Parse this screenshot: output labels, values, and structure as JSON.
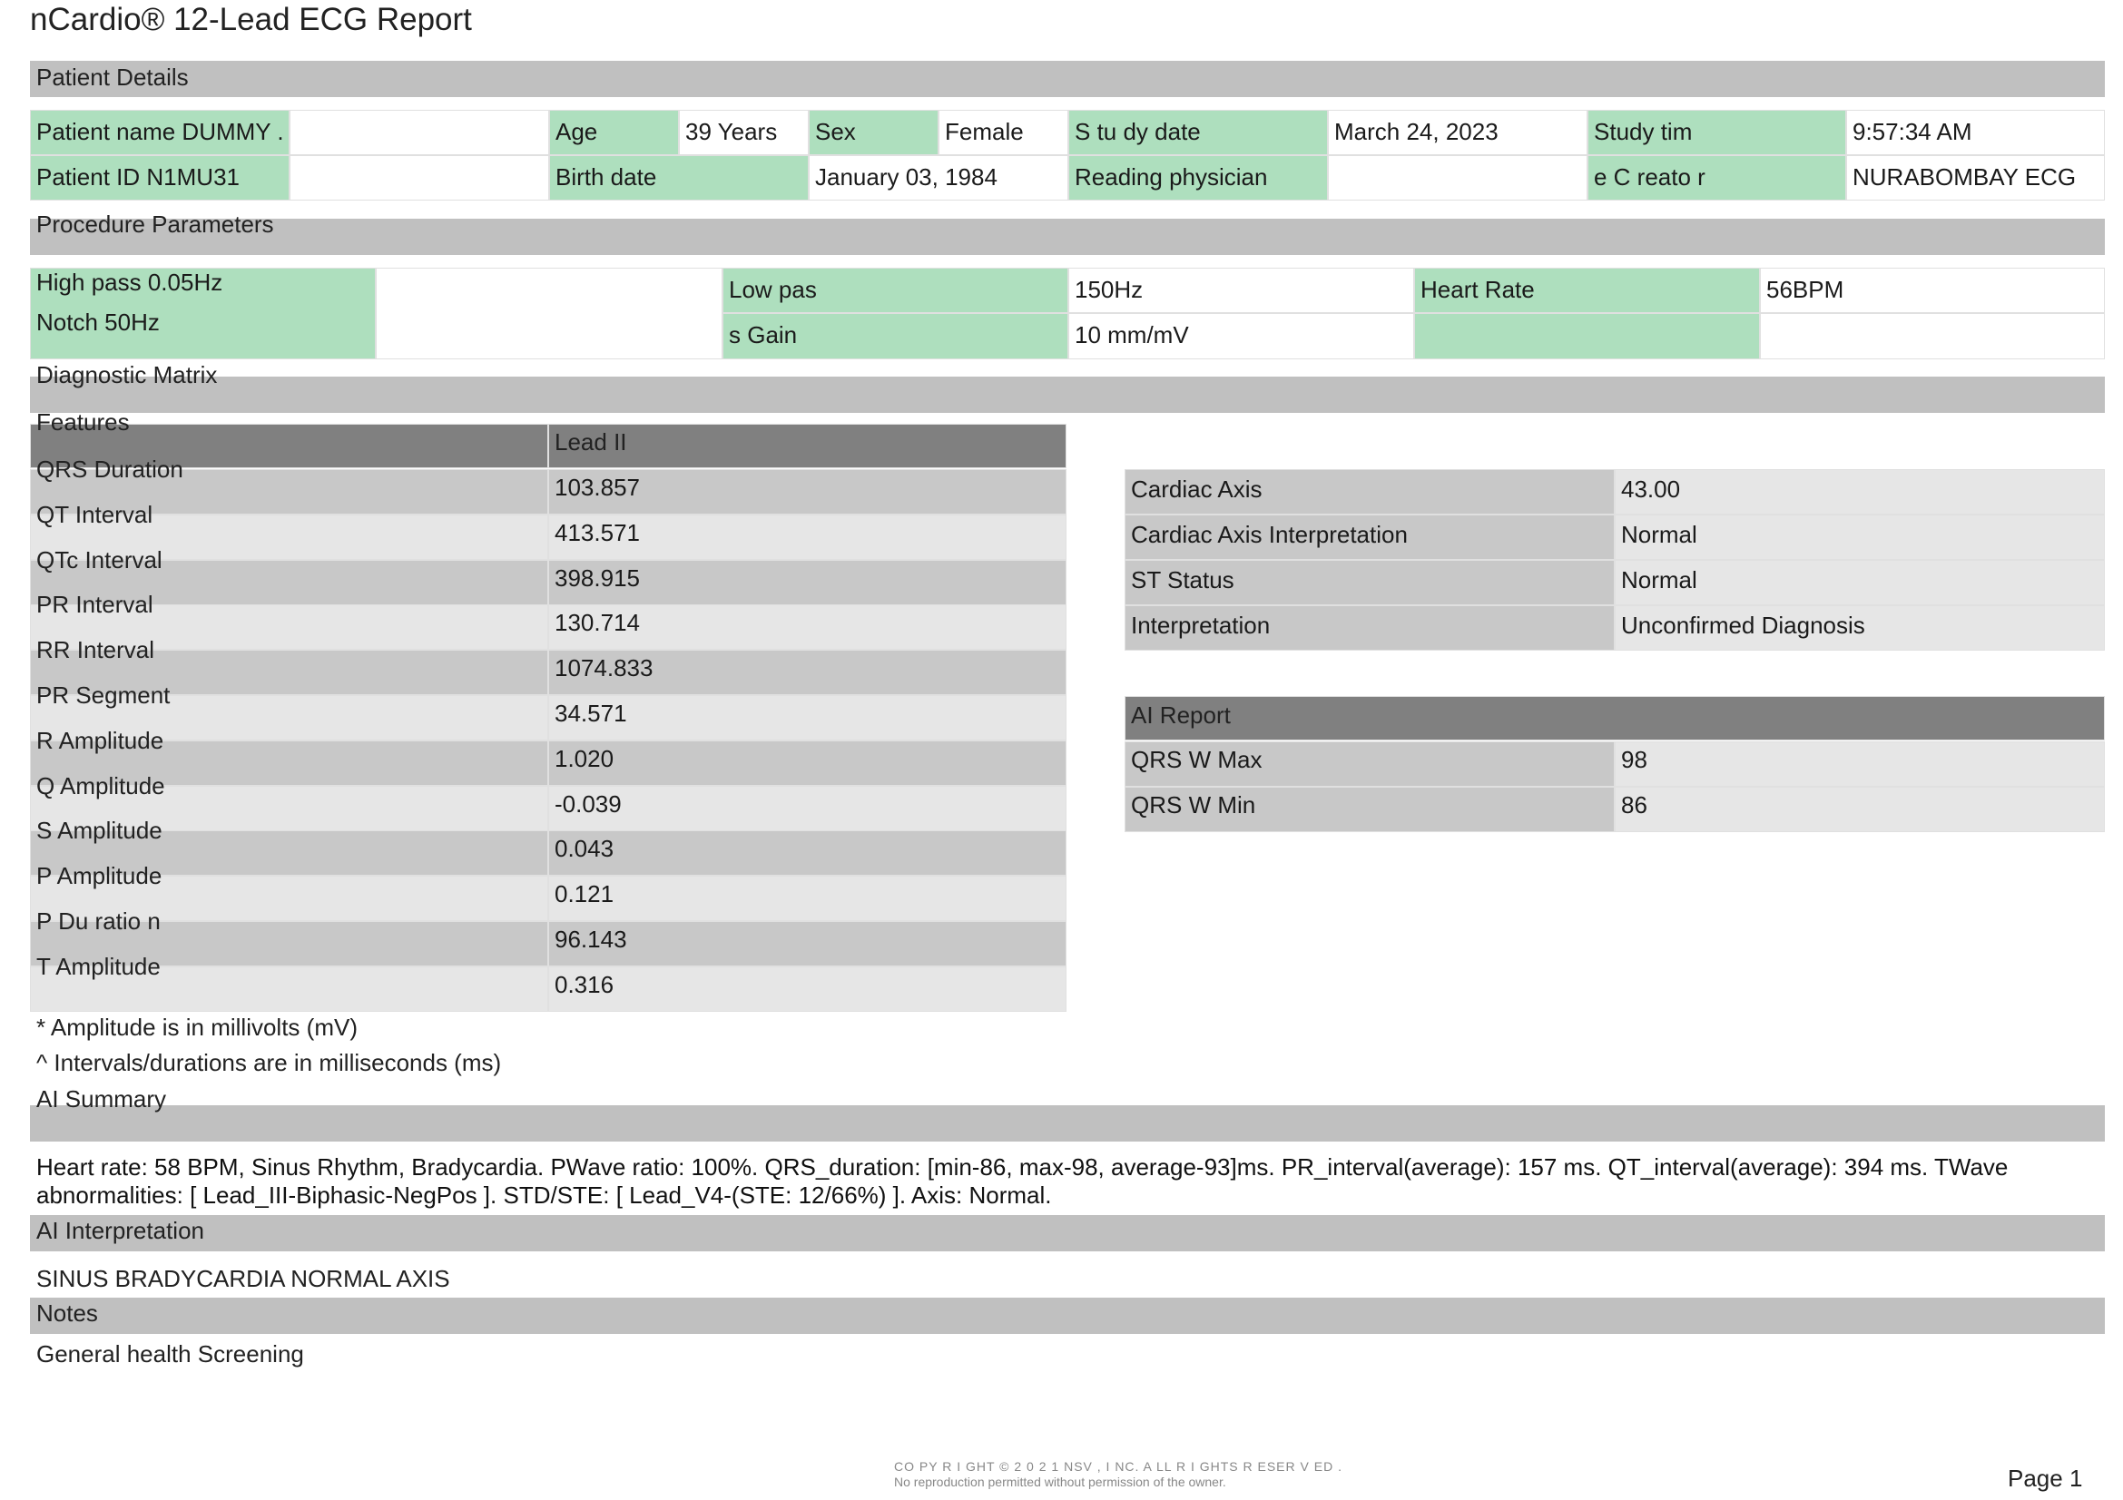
{
  "report": {
    "title": "nCardio® 12-Lead ECG Report"
  },
  "sections": {
    "patient_details": "Patient Details",
    "procedure_parameters": "Procedure Parameters",
    "diagnostic_matrix": "Diagnostic Matrix",
    "ai_summary": "AI Summary",
    "ai_interpretation": "AI Interpretation",
    "notes": "Notes"
  },
  "patient": {
    "name_label": "Patient name DUMMY .",
    "age_label": "Age",
    "age_value": "39 Years",
    "sex_label": "Sex",
    "sex_value": "Female",
    "study_date_label": "S tu dy  date",
    "study_date_value": "March 24, 2023",
    "study_time_label": "Study   tim",
    "study_time_value": "9:57:34  AM",
    "id_label": "Patient ID N1MU31",
    "birth_date_label": "Birth date",
    "birth_date_value": "January 03, 1984",
    "reading_physician_label": "Reading physician",
    "reading_physician_value": "",
    "creator_label": "e C reato r",
    "creator_value": "NURABOMBAY ECG"
  },
  "procedure": {
    "high_pass": "High pass 0.05Hz",
    "notch": "Notch 50Hz",
    "low_pass_label": "Low   pas",
    "low_pass_value": "150Hz",
    "gain_label": "s Gain",
    "gain_value": "10 mm/mV",
    "heart_rate_label": "Heart Rate",
    "heart_rate_value": "56BPM"
  },
  "features": {
    "header_label": "Features",
    "lead_header": "Lead II",
    "rows": [
      {
        "name": "QRS Duration",
        "value": "103.857"
      },
      {
        "name": "QT Interval",
        "value": "413.571"
      },
      {
        "name": "QTc Interval",
        "value": "398.915"
      },
      {
        "name": "PR Interval",
        "value": "130.714"
      },
      {
        "name": "RR Interval",
        "value": "1074.833"
      },
      {
        "name": "PR Segment",
        "value": "34.571"
      },
      {
        "name": "R Amplitude",
        "value": "1.020"
      },
      {
        "name": "Q Amplitude",
        "value": "-0.039"
      },
      {
        "name": "S Amplitude",
        "value": "0.043"
      },
      {
        "name": "P Amplitude",
        "value": "0.121"
      },
      {
        "name": "P  Du ratio n",
        "value": "96.143"
      },
      {
        "name": "T Amplitude",
        "value": "0.316"
      }
    ]
  },
  "axis_table": [
    {
      "label": "Cardiac Axis",
      "value": "43.00"
    },
    {
      "label": "Cardiac Axis Interpretation",
      "value": "Normal"
    },
    {
      "label": "ST Status",
      "value": "Normal"
    },
    {
      "label": "Interpretation",
      "value": "Unconfirmed Diagnosis"
    }
  ],
  "ai_report": {
    "header": "AI Report",
    "rows": [
      {
        "label": "QRS W Max",
        "value": "98"
      },
      {
        "label": "QRS W Min",
        "value": "86"
      }
    ]
  },
  "footnotes": {
    "amplitude": "* Amplitude is in millivolts (mV)",
    "intervals": "^ Intervals/durations are in milliseconds (ms)"
  },
  "ai_summary_text": "Heart rate: 58 BPM, Sinus Rhythm, Bradycardia. PWave ratio: 100%. QRS_duration: [min-86, max-98, average-93]ms. PR_interval(average): 157 ms. QT_interval(average): 394 ms. TWave abnormalities: [ Lead_III-Biphasic-NegPos ]. STD/STE: [ Lead_V4-(STE: 12/66%) ]. Axis: Normal.",
  "ai_interpretation_text": "SINUS BRADYCARDIA NORMAL AXIS",
  "notes_text": "General health Screening",
  "footer": {
    "copyright": "CO PY R I GHT © 2 0 2 1  NSV ,  I NC. A LL R I GHTS R ESER V ED .",
    "reproduction": "No reproduction permitted without permission of the owner.",
    "page": "Page 1"
  }
}
